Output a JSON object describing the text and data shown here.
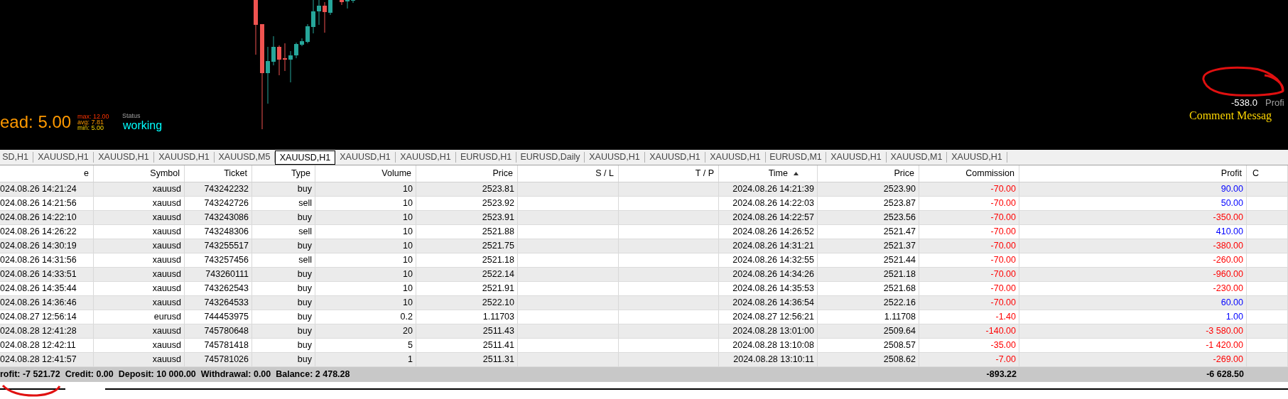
{
  "chart": {
    "spread": {
      "label": "ead: 5.00",
      "max": "max: 12.00",
      "avg": "avg: 7.81",
      "min": "min: 5.00"
    },
    "status": {
      "label": "Status",
      "value": "working"
    },
    "profit": {
      "value": "-538.0",
      "label": "Profi"
    },
    "comment": "Comment Messag"
  },
  "tabs": [
    {
      "label": "SD,H1",
      "selected": false
    },
    {
      "label": "XAUUSD,H1",
      "selected": false
    },
    {
      "label": "XAUUSD,H1",
      "selected": false
    },
    {
      "label": "XAUUSD,H1",
      "selected": false
    },
    {
      "label": "XAUUSD,M5",
      "selected": false
    },
    {
      "label": "XAUUSD,H1",
      "selected": true
    },
    {
      "label": "XAUUSD,H1",
      "selected": false
    },
    {
      "label": "XAUUSD,H1",
      "selected": false
    },
    {
      "label": "EURUSD,H1",
      "selected": false
    },
    {
      "label": "EURUSD,Daily",
      "selected": false
    },
    {
      "label": "XAUUSD,H1",
      "selected": false
    },
    {
      "label": "XAUUSD,H1",
      "selected": false
    },
    {
      "label": "XAUUSD,H1",
      "selected": false
    },
    {
      "label": "EURUSD,M1",
      "selected": false
    },
    {
      "label": "XAUUSD,H1",
      "selected": false
    },
    {
      "label": "XAUUSD,M1",
      "selected": false
    },
    {
      "label": "XAUUSD,H1",
      "selected": false
    }
  ],
  "table": {
    "columns": [
      {
        "label": "e",
        "sorted": false
      },
      {
        "label": "Symbol",
        "sorted": false
      },
      {
        "label": "Ticket",
        "sorted": false
      },
      {
        "label": "Type",
        "sorted": false
      },
      {
        "label": "Volume",
        "sorted": false
      },
      {
        "label": "Price",
        "sorted": false
      },
      {
        "label": "S / L",
        "sorted": false
      },
      {
        "label": "T / P",
        "sorted": false
      },
      {
        "label": "Time",
        "sorted": true
      },
      {
        "label": "Price",
        "sorted": false
      },
      {
        "label": "Commission",
        "sorted": false
      },
      {
        "label": "Profit",
        "sorted": false
      },
      {
        "label": "C",
        "sorted": false
      }
    ],
    "rows": [
      {
        "cells": [
          "024.08.26 14:21:24",
          "xauusd",
          "743242232",
          "buy",
          "10",
          "2523.81",
          "",
          "",
          "2024.08.26 14:21:39",
          "2523.90",
          "-70.00",
          "90.00"
        ],
        "color": "#0000ff"
      },
      {
        "cells": [
          "024.08.26 14:21:56",
          "xauusd",
          "743242726",
          "sell",
          "10",
          "2523.92",
          "",
          "",
          "2024.08.26 14:22:03",
          "2523.87",
          "-70.00",
          "50.00"
        ],
        "color": "#0000ff"
      },
      {
        "cells": [
          "024.08.26 14:22:10",
          "xauusd",
          "743243086",
          "buy",
          "10",
          "2523.91",
          "",
          "",
          "2024.08.26 14:22:57",
          "2523.56",
          "-70.00",
          "-350.00"
        ],
        "color": "#ff0000"
      },
      {
        "cells": [
          "024.08.26 14:26:22",
          "xauusd",
          "743248306",
          "sell",
          "10",
          "2521.88",
          "",
          "",
          "2024.08.26 14:26:52",
          "2521.47",
          "-70.00",
          "410.00"
        ],
        "color": "#0000ff"
      },
      {
        "cells": [
          "024.08.26 14:30:19",
          "xauusd",
          "743255517",
          "buy",
          "10",
          "2521.75",
          "",
          "",
          "2024.08.26 14:31:21",
          "2521.37",
          "-70.00",
          "-380.00"
        ],
        "color": "#ff0000"
      },
      {
        "cells": [
          "024.08.26 14:31:56",
          "xauusd",
          "743257456",
          "sell",
          "10",
          "2521.18",
          "",
          "",
          "2024.08.26 14:32:55",
          "2521.44",
          "-70.00",
          "-260.00"
        ],
        "color": "#ff0000"
      },
      {
        "cells": [
          "024.08.26 14:33:51",
          "xauusd",
          "743260111",
          "buy",
          "10",
          "2522.14",
          "",
          "",
          "2024.08.26 14:34:26",
          "2521.18",
          "-70.00",
          "-960.00"
        ],
        "color": "#ff0000"
      },
      {
        "cells": [
          "024.08.26 14:35:44",
          "xauusd",
          "743262543",
          "buy",
          "10",
          "2521.91",
          "",
          "",
          "2024.08.26 14:35:53",
          "2521.68",
          "-70.00",
          "-230.00"
        ],
        "color": "#ff0000"
      },
      {
        "cells": [
          "024.08.26 14:36:46",
          "xauusd",
          "743264533",
          "buy",
          "10",
          "2522.10",
          "",
          "",
          "2024.08.26 14:36:54",
          "2522.16",
          "-70.00",
          "60.00"
        ],
        "color": "#0000ff"
      },
      {
        "cells": [
          "024.08.27 12:56:14",
          "eurusd",
          "744453975",
          "buy",
          "0.2",
          "1.11703",
          "",
          "",
          "2024.08.27 12:56:21",
          "1.11708",
          "-1.40",
          "1.00"
        ],
        "color": "#0000ff"
      },
      {
        "cells": [
          "024.08.28 12:41:28",
          "xauusd",
          "745780648",
          "buy",
          "20",
          "2511.43",
          "",
          "",
          "2024.08.28 13:01:00",
          "2509.64",
          "-140.00",
          "-3 580.00"
        ],
        "color": "#ff0000"
      },
      {
        "cells": [
          "024.08.28 12:42:11",
          "xauusd",
          "745781418",
          "buy",
          "5",
          "2511.41",
          "",
          "",
          "2024.08.28 13:10:08",
          "2508.57",
          "-35.00",
          "-1 420.00"
        ],
        "color": "#ff0000"
      },
      {
        "cells": [
          "024.08.28 12:41:57",
          "xauusd",
          "745781026",
          "buy",
          "1",
          "2511.31",
          "",
          "",
          "2024.08.28 13:10:11",
          "2508.62",
          "-7.00",
          "-269.00"
        ],
        "color": "#ff0000"
      }
    ],
    "footer": {
      "summary": "rofit: -7 521.72  Credit: 0.00  Deposit: 10 000.00  Withdrawal: 0.00  Balance: 2 478.28",
      "commission": "-893.22",
      "profit": "-6 628.50"
    }
  }
}
